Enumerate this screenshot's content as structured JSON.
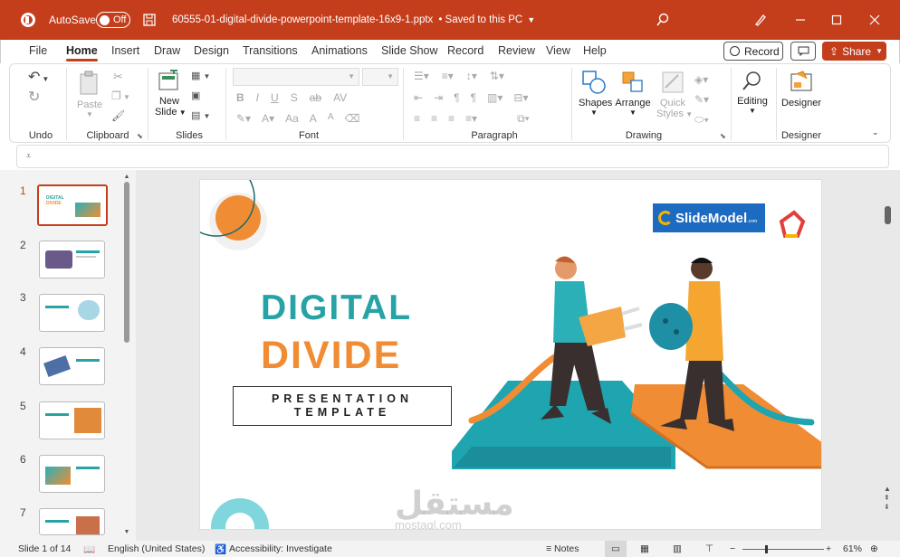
{
  "titlebar": {
    "autosave_label": "AutoSave",
    "autosave_state": "Off",
    "filename": "60555-01-digital-divide-powerpoint-template-16x9-1.pptx",
    "save_status": "• Saved to this PC",
    "accent": "#c43e1c"
  },
  "tabs": [
    "File",
    "Home",
    "Insert",
    "Draw",
    "Design",
    "Transitions",
    "Animations",
    "Slide Show",
    "Record",
    "Review",
    "View",
    "Help"
  ],
  "record_label": "Record",
  "share_label": "Share",
  "ribbon": {
    "undo_label": "Undo",
    "clipboard": {
      "paste": "Paste",
      "label": "Clipboard"
    },
    "slides": {
      "new_slide_1": "New",
      "new_slide_2": "Slide",
      "label": "Slides"
    },
    "font": {
      "label": "Font",
      "bold": "B",
      "italic": "I",
      "underline": "U",
      "strike": "S",
      "shadow": "ab",
      "spacing": "AV",
      "case": "Aa",
      "grow": "A",
      "shrink": "A"
    },
    "paragraph": {
      "label": "Paragraph"
    },
    "drawing": {
      "shapes": "Shapes",
      "arrange": "Arrange",
      "quick_1": "Quick",
      "quick_2": "Styles",
      "label": "Drawing"
    },
    "editing": {
      "label": "Editing"
    },
    "designer": {
      "button": "Designer",
      "label": "Designer"
    }
  },
  "thumbnails": [
    "1",
    "2",
    "3",
    "4",
    "5",
    "6",
    "7"
  ],
  "slide": {
    "brand": "SlideModel",
    "brand_suffix": ".com",
    "title_1": "DIGITAL",
    "title_2": "DIVIDE",
    "sub_1": "PRESENTATION",
    "sub_2": "TEMPLATE",
    "watermark_ar": "مستقل",
    "watermark_url": "mostaql.com"
  },
  "status": {
    "slide_count": "Slide 1 of 14",
    "language": "English (United States)",
    "accessibility": "Accessibility: Investigate",
    "notes": "Notes",
    "zoom": "61%",
    "zoom_level": 0.61
  }
}
